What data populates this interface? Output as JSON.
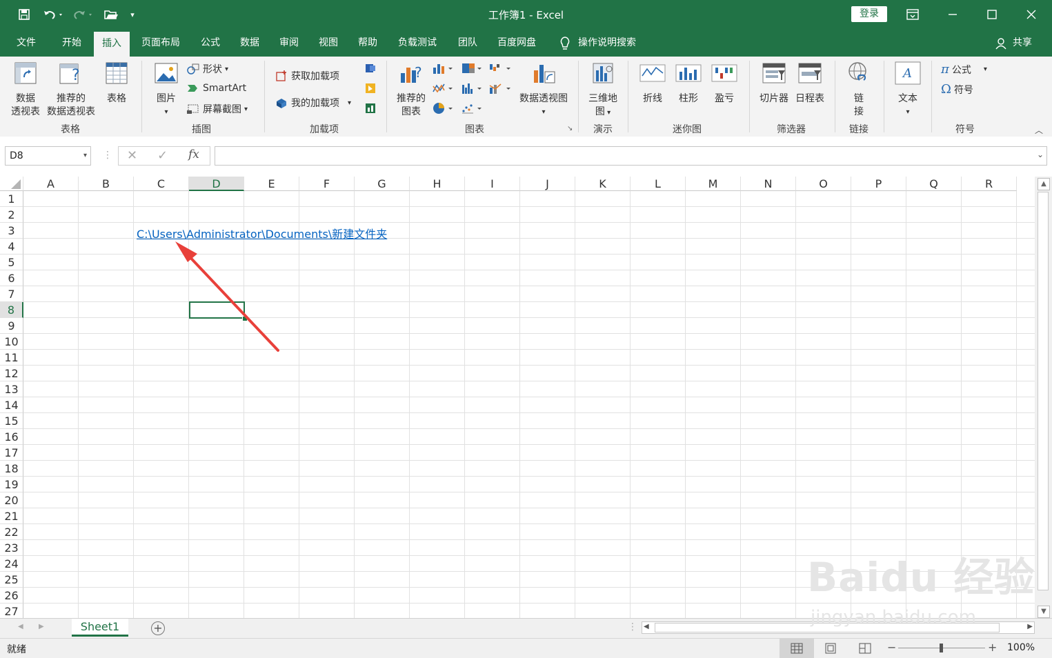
{
  "window": {
    "title": "工作簿1  -  Excel",
    "login_label": "登录",
    "share_label": "共享"
  },
  "tabs": [
    {
      "label": "文件"
    },
    {
      "label": "开始"
    },
    {
      "label": "插入",
      "active": true
    },
    {
      "label": "页面布局"
    },
    {
      "label": "公式"
    },
    {
      "label": "数据"
    },
    {
      "label": "审阅"
    },
    {
      "label": "视图"
    },
    {
      "label": "帮助"
    },
    {
      "label": "负载测试"
    },
    {
      "label": "团队"
    },
    {
      "label": "百度网盘"
    }
  ],
  "tell_me": "操作说明搜索",
  "ribbon": {
    "groups": {
      "tables": "表格",
      "illustrations": "插图",
      "addins": "加载项",
      "charts": "图表",
      "tours": "演示",
      "sparklines": "迷你图",
      "filters": "筛选器",
      "links": "链接",
      "symbols": "符号"
    },
    "buttons": {
      "pivot_line1": "数据",
      "pivot_line2": "透视表",
      "rec_pivot_line1": "推荐的",
      "rec_pivot_line2": "数据透视表",
      "table": "表格",
      "picture": "图片",
      "shapes": "形状",
      "smartart": "SmartArt",
      "screenshot": "屏幕截图",
      "get_addins": "获取加载项",
      "my_addins": "我的加载项",
      "rec_charts_line1": "推荐的",
      "rec_charts_line2": "图表",
      "pivot_chart": "数据透视图",
      "map3d_line1": "三维地",
      "map3d_line2": "图",
      "line": "折线",
      "column": "柱形",
      "winloss": "盈亏",
      "slicer": "切片器",
      "timeline": "日程表",
      "link_line1": "链",
      "link_line2": "接",
      "text": "文本",
      "equation": "公式",
      "symbol": "符号"
    }
  },
  "formula_bar": {
    "name_box": "D8",
    "fx": "fx",
    "value": ""
  },
  "sheet": {
    "columns": [
      "A",
      "B",
      "C",
      "D",
      "E",
      "F",
      "G",
      "H",
      "I",
      "J",
      "K",
      "L",
      "M",
      "N",
      "O",
      "P",
      "Q",
      "R"
    ],
    "rows": [
      "1",
      "2",
      "3",
      "4",
      "5",
      "6",
      "7",
      "8",
      "9",
      "10",
      "11",
      "12",
      "13",
      "14",
      "15",
      "16",
      "17",
      "18",
      "19",
      "20",
      "21",
      "22",
      "23",
      "24",
      "25",
      "26",
      "27"
    ],
    "selected_cell": "D8",
    "hyperlink_cell": "C3",
    "hyperlink_text": "C:\\Users\\Administrator\\Documents\\新建文件夹"
  },
  "sheet_tabs": [
    {
      "label": "Sheet1",
      "active": true
    }
  ],
  "status": {
    "ready": "就绪",
    "zoom": "100%"
  },
  "watermark": {
    "brand": "Baidu 经验",
    "url": "jingyan.baidu.com"
  },
  "colors": {
    "excel_green": "#217346",
    "hyperlink": "#0563c1",
    "arrow": "#e8403a"
  }
}
